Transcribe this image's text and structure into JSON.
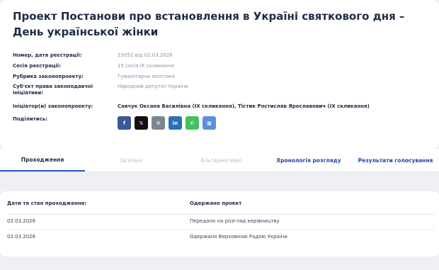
{
  "bill": {
    "title": "Проект Постанови про встановлення в Україні святкового дня – День української жінки"
  },
  "meta": [
    {
      "label": "Номер, дата реєстрації:",
      "value": "15052 від 02.03.2026"
    },
    {
      "label": "Сесія реєстрації:",
      "value": "15 сесія IX скликання"
    },
    {
      "label": "Рубрика законопроекту:",
      "value": "Гуманітарна політика"
    },
    {
      "label": "Суб'єкт права законодавчої ініціативи:",
      "value": "Народний депутат України"
    },
    {
      "label": "Ініціатор(и) законопроекту:",
      "value": "Савчук Оксана Василівна (IX скликання), Тістик Ростислав Ярославович (IX скликання)"
    },
    {
      "label": "Поділитись:"
    }
  ],
  "share": [
    {
      "icon": "facebook-icon",
      "glyph": "f",
      "color": "#3b5998"
    },
    {
      "icon": "x-icon",
      "glyph": "𝕏",
      "color": "#111111"
    },
    {
      "icon": "email-icon",
      "glyph": "✉",
      "color": "#7d8592"
    },
    {
      "icon": "linkedin-icon",
      "glyph": "in",
      "color": "#2d6fb5"
    },
    {
      "icon": "whatsapp-icon",
      "glyph": "✆",
      "color": "#41c163"
    },
    {
      "icon": "qr-code-icon",
      "glyph": "▦",
      "color": "#5d8fe0"
    }
  ],
  "tabs": [
    {
      "label": "Проходження",
      "state": "active"
    },
    {
      "label": "Зв'язані",
      "state": "disabled"
    },
    {
      "label": "Альтернативні",
      "state": "disabled"
    },
    {
      "label": "Хронологія розгляду",
      "state": "link"
    },
    {
      "label": "Результати голосування",
      "state": "link"
    }
  ],
  "passage": {
    "columns": [
      "Дати та стан проходження:",
      "Одержано проект"
    ],
    "rows": [
      {
        "date": "02.03.2026",
        "status": "Передано на розгляд керівництву"
      },
      {
        "date": "02.03.2026",
        "status": "Одержано Верховною Радою України"
      }
    ]
  }
}
